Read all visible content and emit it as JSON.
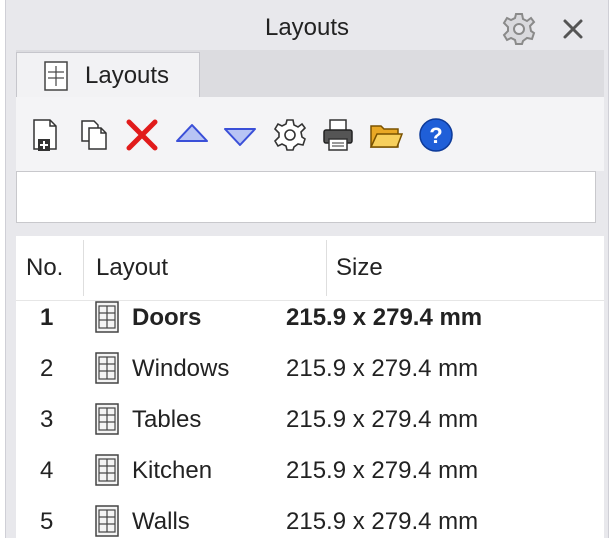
{
  "panel": {
    "title": "Layouts",
    "settings_icon": "gear-icon",
    "close_icon": "close-icon"
  },
  "tabs": [
    {
      "label": "Layouts",
      "icon": "layout-page-icon",
      "active": true
    }
  ],
  "toolbar": {
    "buttons": [
      {
        "name": "new-layout",
        "icon": "new-page-icon"
      },
      {
        "name": "copy-layout",
        "icon": "copy-icon"
      },
      {
        "name": "delete-layout",
        "icon": "delete-x-icon",
        "color": "#e11b1b"
      },
      {
        "name": "move-up",
        "icon": "triangle-up-icon",
        "color": "#3a4fd8"
      },
      {
        "name": "move-down",
        "icon": "triangle-down-icon",
        "color": "#3a4fd8"
      },
      {
        "name": "properties",
        "icon": "gear-icon"
      },
      {
        "name": "print",
        "icon": "printer-icon"
      },
      {
        "name": "open",
        "icon": "folder-open-icon",
        "color": "#e9a825"
      },
      {
        "name": "help",
        "icon": "help-icon",
        "color": "#1f5fd8"
      }
    ]
  },
  "filter": {
    "value": "",
    "placeholder": ""
  },
  "table": {
    "columns": [
      "No.",
      "Layout",
      "Size"
    ],
    "rows": [
      {
        "no": "1",
        "name": "Doors",
        "size": "215.9 x 279.4 mm",
        "current": true
      },
      {
        "no": "2",
        "name": "Windows",
        "size": "215.9 x 279.4 mm",
        "current": false
      },
      {
        "no": "3",
        "name": "Tables",
        "size": "215.9 x 279.4 mm",
        "current": false
      },
      {
        "no": "4",
        "name": "Kitchen",
        "size": "215.9 x 279.4 mm",
        "current": false
      },
      {
        "no": "5",
        "name": "Walls",
        "size": "215.9 x 279.4 mm",
        "current": false
      }
    ]
  }
}
